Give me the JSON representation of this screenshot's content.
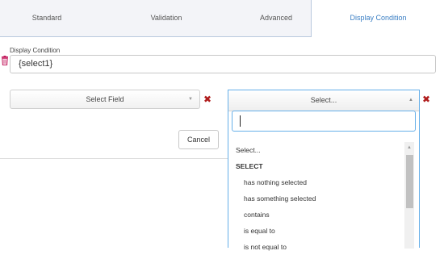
{
  "tabs": [
    {
      "label": "Standard",
      "active": false
    },
    {
      "label": "Validation",
      "active": false
    },
    {
      "label": "Advanced",
      "active": false
    },
    {
      "label": "Display Condition",
      "active": true
    }
  ],
  "display_condition": {
    "label": "Display Condition",
    "value": "{select1}"
  },
  "field_select": {
    "value": "Select Field"
  },
  "operator_select": {
    "value": "Select...",
    "search_value": "",
    "options": [
      {
        "label": "Select...",
        "kind": "placeholder"
      },
      {
        "label": "SELECT",
        "kind": "group"
      },
      {
        "label": "has nothing selected",
        "kind": "option"
      },
      {
        "label": "has something selected",
        "kind": "option"
      },
      {
        "label": "contains",
        "kind": "option"
      },
      {
        "label": "is equal to",
        "kind": "option"
      },
      {
        "label": "is not equal to",
        "kind": "option"
      }
    ]
  },
  "buttons": {
    "cancel": "Cancel"
  },
  "colors": {
    "accent": "#3b7fc4",
    "remove": "#b01c1c",
    "focus": "#66afe9"
  },
  "icons": {
    "remove": "close-icon",
    "delete": "trash-icon",
    "caret": "caret-down-icon"
  }
}
